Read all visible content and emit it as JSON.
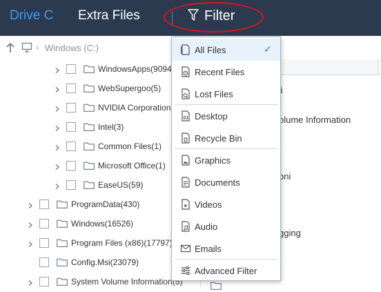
{
  "header": {
    "tabs": [
      {
        "label": "Drive C"
      },
      {
        "label": "Extra Files"
      }
    ],
    "filter_label": "Filter"
  },
  "pathbar": {
    "path": "Windows (C:)"
  },
  "tree": {
    "items": [
      {
        "label": "WindowsApps(9094)"
      },
      {
        "label": "WebSupergoo(5)"
      },
      {
        "label": "NVIDIA Corporation"
      },
      {
        "label": "Intel(3)"
      },
      {
        "label": "Common Files(1)"
      },
      {
        "label": "Microsoft Office(1)"
      },
      {
        "label": "EaseUS(59)"
      },
      {
        "label": "ProgramData(430)"
      },
      {
        "label": "Windows(16526)"
      },
      {
        "label": "Program Files (x86)(17797)"
      },
      {
        "label": "Config.Msi(23079)"
      },
      {
        "label": "System Volume Information(5)"
      }
    ]
  },
  "list": {
    "rows": [
      {
        "text": "si"
      },
      {
        "text": "olume Information"
      },
      {
        "text": "oni"
      },
      {
        "text": "gging"
      }
    ]
  },
  "menu": {
    "items": [
      {
        "label": "All Files",
        "selected": true
      },
      {
        "label": "Recent Files"
      },
      {
        "label": "Lost Files"
      },
      {
        "label": "Desktop"
      },
      {
        "label": "Recycle Bin"
      },
      {
        "label": "Graphics"
      },
      {
        "label": "Documents"
      },
      {
        "label": "Videos"
      },
      {
        "label": "Audio"
      },
      {
        "label": "Emails"
      },
      {
        "label": "Advanced Filter"
      }
    ],
    "check_mark": "✓"
  },
  "colors": {
    "header_bg": "#2c3a4f",
    "active_tab": "#3b9cf2",
    "highlight": "#d7151c",
    "accent": "#2a84d8"
  }
}
